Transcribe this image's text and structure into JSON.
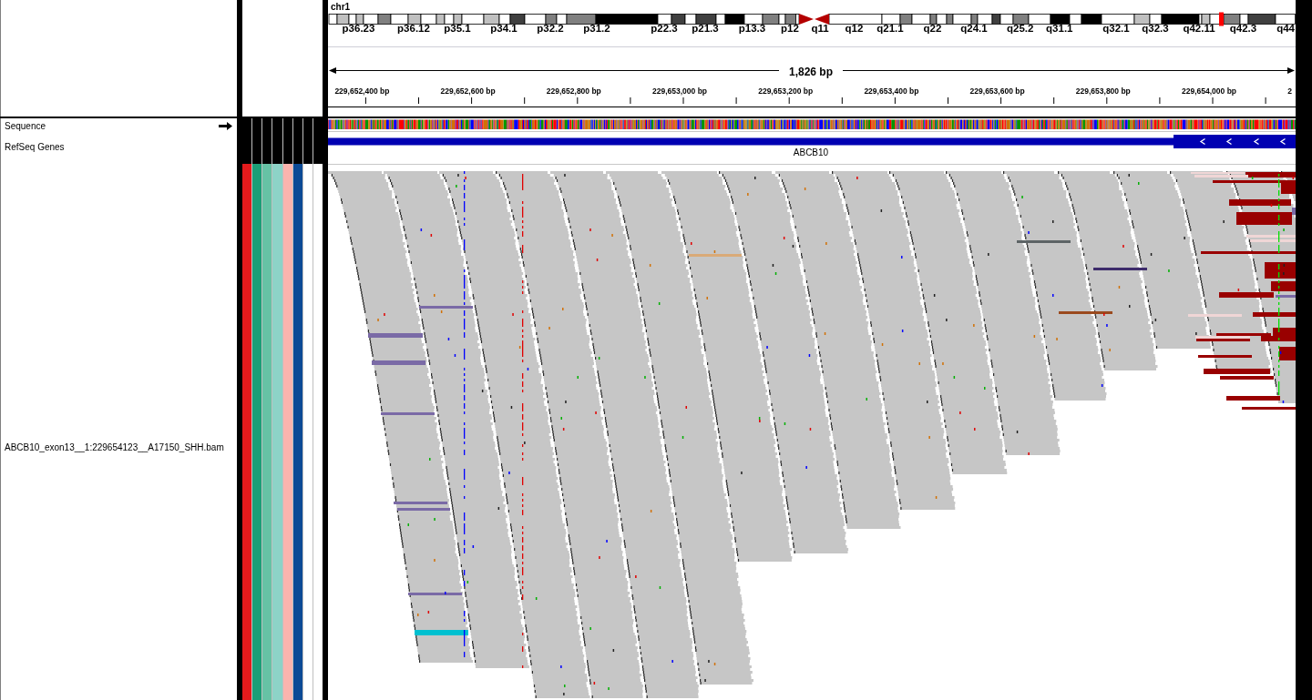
{
  "header": {
    "chromosome": "chr1",
    "cytobands": [
      "p36.23",
      "p36.12",
      "p35.1",
      "p34.1",
      "p32.2",
      "p31.2",
      "p22.3",
      "p21.3",
      "p13.3",
      "p12",
      "q11",
      "q12",
      "q21.1",
      "q22",
      "q24.1",
      "q25.2",
      "q31.1",
      "q32.1",
      "q32.3",
      "q42.11",
      "q42.3",
      "q44"
    ],
    "span": "1,826 bp",
    "ruler_labels": [
      "229,652,400 bp",
      "229,652,600 bp",
      "229,652,800 bp",
      "229,653,000 bp",
      "229,653,200 bp",
      "229,653,400 bp",
      "229,653,600 bp",
      "229,653,800 bp",
      "229,654,000 bp",
      "2"
    ]
  },
  "tracks": [
    {
      "kind": "sequence",
      "name": "Sequence",
      "reverse_strand": false
    },
    {
      "kind": "gene",
      "name": "RefSeq Genes",
      "gene": {
        "label": "ABCB10",
        "reverse_strand": true
      }
    },
    {
      "kind": "alignment",
      "name": "ABCB10_exon13__1:229654123__A17150_SHH.bam"
    }
  ],
  "attributes": [
    {
      "color": "#e41a1c"
    },
    {
      "color": "#1b9e77"
    },
    {
      "color": "#66c2a5"
    },
    {
      "color": "#8dd3c7"
    },
    {
      "color": "#fbb4ae"
    },
    {
      "color": "#0c4a96"
    },
    {
      "color": "#ffffff"
    },
    {
      "color": "#ffffff"
    }
  ]
}
